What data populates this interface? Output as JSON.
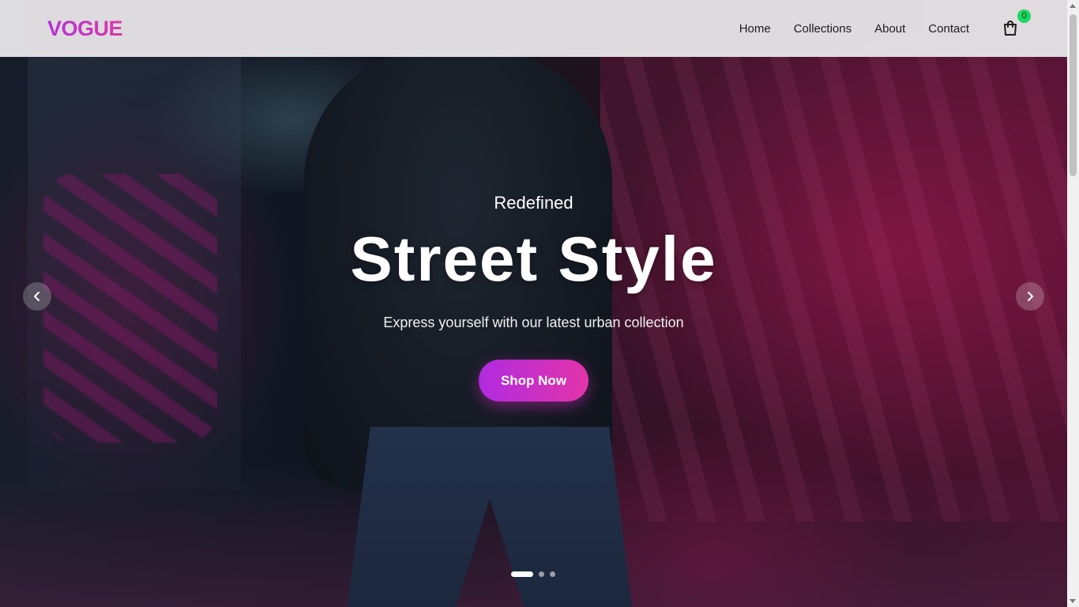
{
  "brand": {
    "name": "VOGUE"
  },
  "nav": {
    "items": [
      {
        "label": "Home"
      },
      {
        "label": "Collections"
      },
      {
        "label": "About"
      },
      {
        "label": "Contact"
      }
    ],
    "cart": {
      "icon": "shopping-bag-icon",
      "count": "0"
    }
  },
  "hero": {
    "eyebrow": "Redefined",
    "title": "Street Style",
    "subtitle": "Express yourself with our latest urban collection",
    "cta_label": "Shop Now",
    "prev_icon": "chevron-left-icon",
    "next_icon": "chevron-right-icon",
    "slides": {
      "count": 3,
      "active": 1
    }
  },
  "colors": {
    "brand_gradient_start": "#b630d8",
    "brand_gradient_end": "#d63aa8",
    "cta_start": "#b02be0",
    "cta_end": "#e234a9",
    "cart_badge": "#1bd860"
  }
}
